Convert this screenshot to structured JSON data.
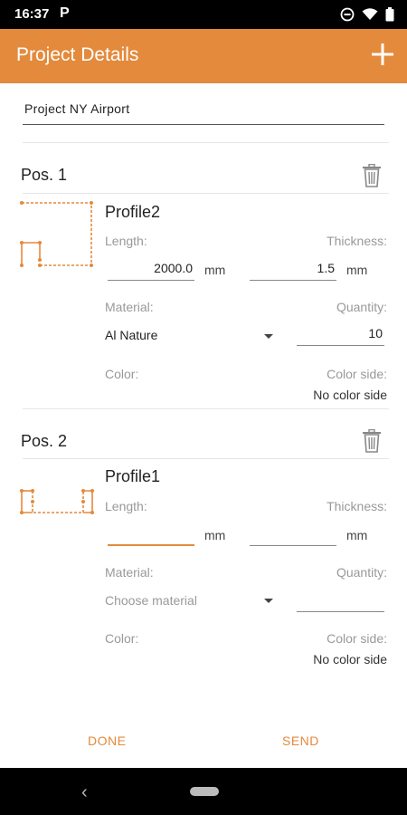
{
  "status": {
    "time": "16:37",
    "app_letter": "P"
  },
  "app_bar": {
    "title": "Project Details"
  },
  "project": {
    "name": "Project NY Airport"
  },
  "positions": [
    {
      "title": "Pos. 1",
      "profile_name": "Profile2",
      "length_label": "Length:",
      "length_value": "2000.0",
      "length_unit": "mm",
      "thickness_label": "Thickness:",
      "thickness_value": "1.5",
      "thickness_unit": "mm",
      "material_label": "Material:",
      "material_value": "Al Nature",
      "quantity_label": "Quantity:",
      "quantity_value": "10",
      "color_label": "Color:",
      "color_side_label": "Color side:",
      "color_side_value": "No color side"
    },
    {
      "title": "Pos. 2",
      "profile_name": "Profile1",
      "length_label": "Length:",
      "length_value": "",
      "length_unit": "mm",
      "thickness_label": "Thickness:",
      "thickness_value": "",
      "thickness_unit": "mm",
      "material_label": "Material:",
      "material_placeholder": "Choose material",
      "quantity_label": "Quantity:",
      "quantity_value": "",
      "color_label": "Color:",
      "color_side_label": "Color side:",
      "color_side_value": "No color side"
    }
  ],
  "footer": {
    "done_label": "DONE",
    "send_label": "SEND"
  },
  "colors": {
    "accent": "#e48a3c",
    "status_bar": "#000000"
  },
  "icons": [
    "add-icon",
    "trash-icon",
    "chevron-down-icon",
    "back-icon",
    "home-pill-icon",
    "wifi-icon",
    "battery-icon",
    "do-not-disturb-icon"
  ]
}
